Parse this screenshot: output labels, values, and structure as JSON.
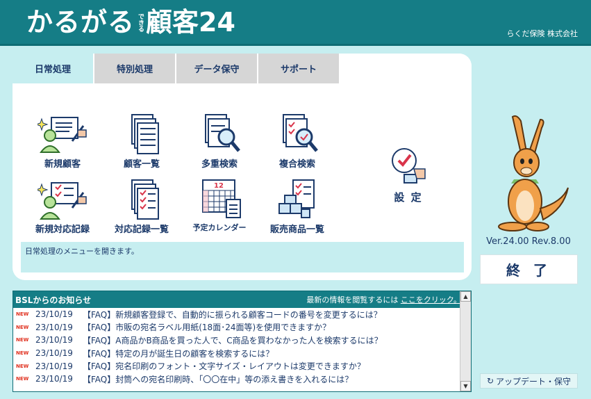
{
  "header": {
    "logo_main": "かるがる",
    "logo_small": "できる",
    "logo_title": "顧客24",
    "company": "らくだ保険 株式会社"
  },
  "tabs": [
    {
      "label": "日常処理",
      "active": true
    },
    {
      "label": "特別処理",
      "active": false
    },
    {
      "label": "データ保守",
      "active": false
    },
    {
      "label": "サポート",
      "active": false
    }
  ],
  "menu": {
    "new_customer": "新規顧客",
    "customer_list": "顧客一覧",
    "multi_search": "多重検索",
    "compound_search": "複合検索",
    "new_record": "新規対応記録",
    "record_list": "対応記録一覧",
    "calendar": "予定カレンダー",
    "calendar_icon_number": "12",
    "products": "販売商品一覧",
    "settings": "設 定"
  },
  "description": "日常処理のメニューを開きます。",
  "version": "Ver.24.00 Rev.8.00",
  "exit_label": "終 了",
  "update_label": "アップデート・保守",
  "update_icon": "refresh-icon",
  "news": {
    "title": "BSLからのお知らせ",
    "link_prefix": "最新の情報を閲覧するには",
    "link_text": "ここをクリック。",
    "new_badge": "NEW",
    "items": [
      {
        "date": "23/10/19",
        "text": "【FAQ】新規顧客登録で、自動的に振られる顧客コードの番号を変更するには？"
      },
      {
        "date": "23/10/19",
        "text": "【FAQ】市販の宛名ラベル用紙(18面･24面等)を使用できますか？"
      },
      {
        "date": "23/10/19",
        "text": "【FAQ】A商品かB商品を買った人で、C商品を買わなかった人を検索するには？"
      },
      {
        "date": "23/10/19",
        "text": "【FAQ】特定の月が誕生日の顧客を検索するには？"
      },
      {
        "date": "23/10/19",
        "text": "【FAQ】宛名印刷のフォント・文字サイズ・レイアウトは変更できますか？"
      },
      {
        "date": "23/10/19",
        "text": "【FAQ】封筒への宛名印刷時、「〇〇在中」等の添え書きを入れるには？"
      }
    ]
  },
  "colors": {
    "header": "#157d86",
    "background": "#c6eef0",
    "text": "#1c3a6a",
    "new_badge": "#e0301e"
  }
}
